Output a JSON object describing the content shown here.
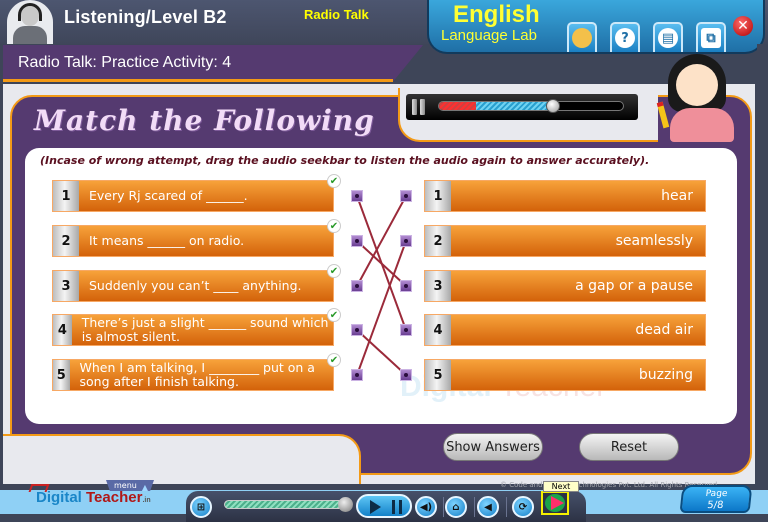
{
  "header": {
    "level_title": "Listening/Level B2",
    "topic": "Radio Talk",
    "brand_line1": "English",
    "brand_line2": "Language Lab",
    "toolbar_icons": [
      "folder-icon",
      "help-icon",
      "book-icon",
      "window-icon"
    ],
    "close_glyph": "✕",
    "help_glyph": "?"
  },
  "activity": {
    "title": "Radio Talk: Practice Activity: 4",
    "heading": "Match the Following",
    "instruction": "(Incase of wrong attempt, drag the audio seekbar to listen the audio again to answer accurately)."
  },
  "audio": {
    "progress_percent": 62,
    "red_portion_percent": 20
  },
  "left_items": [
    {
      "num": "1",
      "text": "Every Rj scared of ______.",
      "correct": true
    },
    {
      "num": "2",
      "text": "It means  ______ on radio.",
      "correct": true
    },
    {
      "num": "3",
      "text": "Suddenly you can’t  ____ anything.",
      "correct": true
    },
    {
      "num": "4",
      "text": "There’s just a slight ______ sound which is almost silent.",
      "correct": true
    },
    {
      "num": "5",
      "text": "When I am talking, I ________ put on a song after I finish talking.",
      "correct": true
    }
  ],
  "right_items": [
    {
      "num": "1",
      "text": "hear"
    },
    {
      "num": "2",
      "text": "seamlessly"
    },
    {
      "num": "3",
      "text": "a gap or a pause"
    },
    {
      "num": "4",
      "text": "dead air"
    },
    {
      "num": "5",
      "text": "buzzing"
    }
  ],
  "matches": [
    [
      1,
      4
    ],
    [
      2,
      3
    ],
    [
      3,
      1
    ],
    [
      4,
      5
    ],
    [
      5,
      2
    ]
  ],
  "check_glyph": "✔",
  "line_color": "#9b2a3a",
  "buttons": {
    "show_answers": "Show Answers",
    "reset": "Reset"
  },
  "footer": {
    "logo_digital": "Digital",
    "logo_teacher": " Teacher",
    "logo_suffix": ".in",
    "menu_label": "menu",
    "menu_arrow": "▲",
    "copyright": "© Code and          ractive Technologies  Pvt. Ltd.  All Rights Reserved",
    "next_tooltip": "Next",
    "page_label": "Page",
    "page_value": "5/8",
    "playback_progress_percent": 92,
    "watermark_digital": "Digital",
    "watermark_teacher": " Teacher"
  }
}
